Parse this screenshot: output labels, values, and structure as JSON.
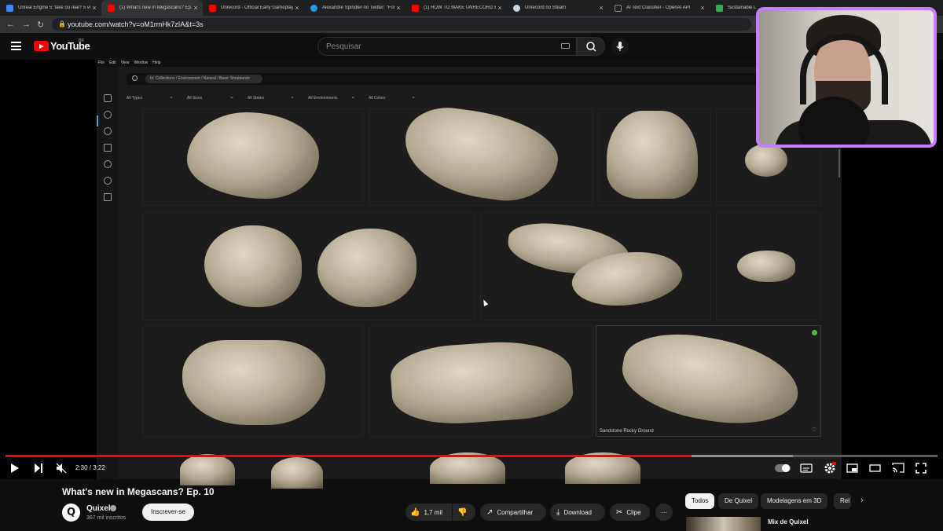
{
  "browser": {
    "tabs": [
      {
        "label": "Unreal Engine 5: fake ou real? 5 vide",
        "color": "#4285f4"
      },
      {
        "label": "(1) What's new in Megascans? Ep. 10",
        "color": "#ff0000"
      },
      {
        "label": "Unrecord - Official Early Gameplay Tr",
        "color": "#ff0000"
      },
      {
        "label": "Alexandre Spindler no Twitter: \"For th",
        "color": "#1d9bf0"
      },
      {
        "label": "(1) HOW TO MAKE UNRECORD BODY",
        "color": "#ff0000"
      },
      {
        "label": "Unrecord no Steam",
        "color": "#c7d5e0"
      },
      {
        "label": "AI Text Classifier - OpenAI API",
        "color": "#202123"
      },
      {
        "label": "Sustainable L",
        "color": "#34a853"
      }
    ],
    "close_glyph": "×",
    "url": "youtube.com/watch?v=oM1rmHk7zIA&t=3s"
  },
  "youtube": {
    "logo_text": "YouTube",
    "region": "BR",
    "search_placeholder": "Pesquisar",
    "video": {
      "menu": [
        "File",
        "Edit",
        "View",
        "Window",
        "Help"
      ],
      "search_chip": "In: Collections / Environment / Natural / Basic Shrublands",
      "filters": [
        "All Types",
        "All Sizes",
        "All States",
        "All Environments",
        "All Colors"
      ],
      "selected_asset_label": "Sandstone Rocky Ground",
      "time": "2:30 / 3:22",
      "progress_fraction": 0.736,
      "buffered_fraction": 0.845
    },
    "title": "What's new in Megascans? Ep. 10",
    "channel": "Quixel",
    "subscribers": "367 mil inscritos",
    "subscribe_label": "Inscrever-se",
    "likes": "1,7 mil",
    "share_label": "Compartilhar",
    "download_label": "Download",
    "clip_label": "Clipe",
    "more_label": "···",
    "chips": [
      "Todos",
      "De Quixel",
      "Modelagens em 3D",
      "Rel"
    ],
    "next_glyph": "›",
    "up_next_title": "Mix de Quixel"
  }
}
